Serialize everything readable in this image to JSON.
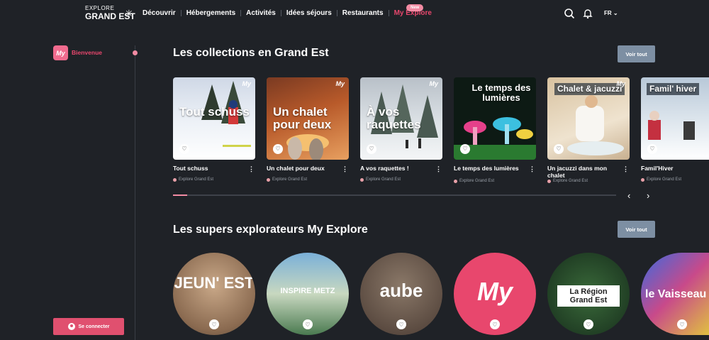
{
  "header": {
    "logo_line1": "EXPLORE",
    "logo_line2": "GRAND EST",
    "nav": [
      "Découvrir",
      "Hébergements",
      "Activités",
      "Idées séjours",
      "Restaurants",
      "My Explore"
    ],
    "new_badge": "New",
    "language": "FR"
  },
  "sidebar": {
    "badge": "My",
    "welcome": "Bienvenue",
    "connect_label": "Se connecter"
  },
  "collections": {
    "title": "Les collections en Grand Est",
    "see_all": "Voir tout",
    "cards": [
      {
        "overlay": "Tout schuss",
        "title": "Tout schuss",
        "source": "Explore Grand Est"
      },
      {
        "overlay": "Un chalet pour deux",
        "title": "Un chalet pour deux",
        "source": "Explore Grand Est"
      },
      {
        "overlay": "À vos raquettes",
        "title": "A vos raquettes !",
        "source": "Explore Grand Est"
      },
      {
        "overlay": "Le temps des lumières",
        "title": "Le temps des lumières",
        "source": "Explore Grand Est"
      },
      {
        "overlay": "Chalet & jacuzzi",
        "title": "Un jacuzzi dans mon chalet",
        "source": "Explore Grand Est"
      },
      {
        "overlay": "Famil' hiver",
        "title": "Famil'Hiver",
        "source": "Explore Grand Est"
      }
    ]
  },
  "explorers": {
    "title": "Les supers explorateurs My Explore",
    "see_all": "Voir tout",
    "items": [
      {
        "label": "JEUN' EST"
      },
      {
        "label": "INSPIRE METZ"
      },
      {
        "label": "aube"
      },
      {
        "label": "My"
      },
      {
        "label": "La Région Grand Est"
      },
      {
        "label": "le Vaisseau"
      }
    ]
  },
  "colors": {
    "background": "#1f2227",
    "accent": "#e8476d",
    "button_grey": "#7d8fa3"
  }
}
